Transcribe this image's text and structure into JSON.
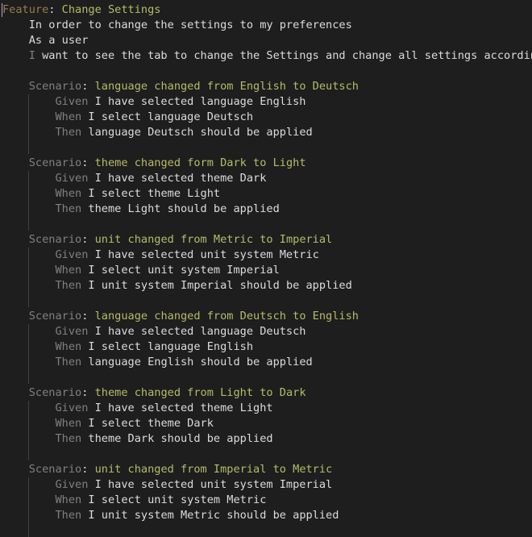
{
  "feature": {
    "keyword": "Feature",
    "title": "Change Settings",
    "narrative": [
      {
        "keyword": "",
        "text": "In order to change the settings to my preferences"
      },
      {
        "keyword": "",
        "text": "As a user"
      },
      {
        "keyword": "I",
        "text": " want to see the tab to change the Settings and change all settings accordingly"
      }
    ]
  },
  "scenarios": [
    {
      "keyword": "Scenario",
      "title": "language changed from English to Deutsch",
      "steps": [
        {
          "keyword": "Given",
          "text": "I have selected language English"
        },
        {
          "keyword": "When",
          "text": "I select language Deutsch"
        },
        {
          "keyword": "Then",
          "text": "language Deutsch should be applied"
        }
      ]
    },
    {
      "keyword": "Scenario",
      "title": "theme changed form Dark to Light",
      "steps": [
        {
          "keyword": "Given",
          "text": "I have selected theme Dark"
        },
        {
          "keyword": "When",
          "text": "I select theme Light"
        },
        {
          "keyword": "Then",
          "text": "theme Light should be applied"
        }
      ]
    },
    {
      "keyword": "Scenario",
      "title": "unit changed from Metric to Imperial",
      "steps": [
        {
          "keyword": "Given",
          "text": "I have selected unit system Metric"
        },
        {
          "keyword": "When",
          "text": "I select unit system Imperial"
        },
        {
          "keyword": "Then",
          "text": "I unit system Imperial should be applied"
        }
      ]
    },
    {
      "keyword": "Scenario",
      "title": "language changed from Deutsch to English",
      "steps": [
        {
          "keyword": "Given",
          "text": "I have selected language Deutsch"
        },
        {
          "keyword": "When",
          "text": "I select language English"
        },
        {
          "keyword": "Then",
          "text": "language English should be applied"
        }
      ]
    },
    {
      "keyword": "Scenario",
      "title": "theme changed from Light to Dark",
      "steps": [
        {
          "keyword": "Given",
          "text": "I have selected theme Light"
        },
        {
          "keyword": "When",
          "text": "I select theme Dark"
        },
        {
          "keyword": "Then",
          "text": "theme Dark should be applied"
        }
      ]
    },
    {
      "keyword": "Scenario",
      "title": "unit changed from Imperial to Metric",
      "steps": [
        {
          "keyword": "Given",
          "text": "I have selected unit system Imperial"
        },
        {
          "keyword": "When",
          "text": "I select unit system Metric"
        },
        {
          "keyword": "Then",
          "text": "I unit system Metric should be applied"
        }
      ]
    }
  ],
  "colors": {
    "background": "#1e1e1e",
    "keyword": "#808080",
    "title": "#b5bd68",
    "text": "#dcdcdc",
    "indent_guide": "#404040"
  }
}
